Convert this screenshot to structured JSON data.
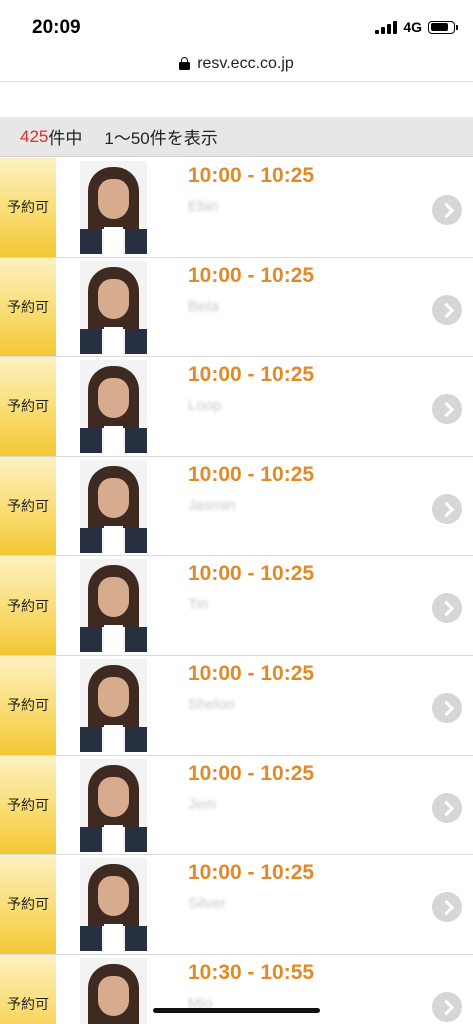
{
  "status_bar": {
    "time": "20:09",
    "network": "4G"
  },
  "browser": {
    "url": "resv.ecc.co.jp"
  },
  "results": {
    "count": "425",
    "count_unit": "件中",
    "range_text": "1〜50件を表示"
  },
  "teachers": [
    {
      "status": "予約可",
      "time": "10:00 - 10:25",
      "name": "Ebin"
    },
    {
      "status": "予約可",
      "time": "10:00 - 10:25",
      "name": "Beta"
    },
    {
      "status": "予約可",
      "time": "10:00 - 10:25",
      "name": "Loop"
    },
    {
      "status": "予約可",
      "time": "10:00 - 10:25",
      "name": "Jasmin"
    },
    {
      "status": "予約可",
      "time": "10:00 - 10:25",
      "name": "Tin"
    },
    {
      "status": "予約可",
      "time": "10:00 - 10:25",
      "name": "Shelon"
    },
    {
      "status": "予約可",
      "time": "10:00 - 10:25",
      "name": "Jem"
    },
    {
      "status": "予約可",
      "time": "10:00 - 10:25",
      "name": "Silver"
    },
    {
      "status": "予約可",
      "time": "10:30 - 10:55",
      "name": "Mio"
    }
  ],
  "colors": {
    "accent_time": "#e08a29",
    "count_red": "#e02c2c",
    "status_yellow": "#f9dc72"
  },
  "icons": {
    "lock": "lock-icon",
    "row_arrow": "chevron-right-icon"
  }
}
